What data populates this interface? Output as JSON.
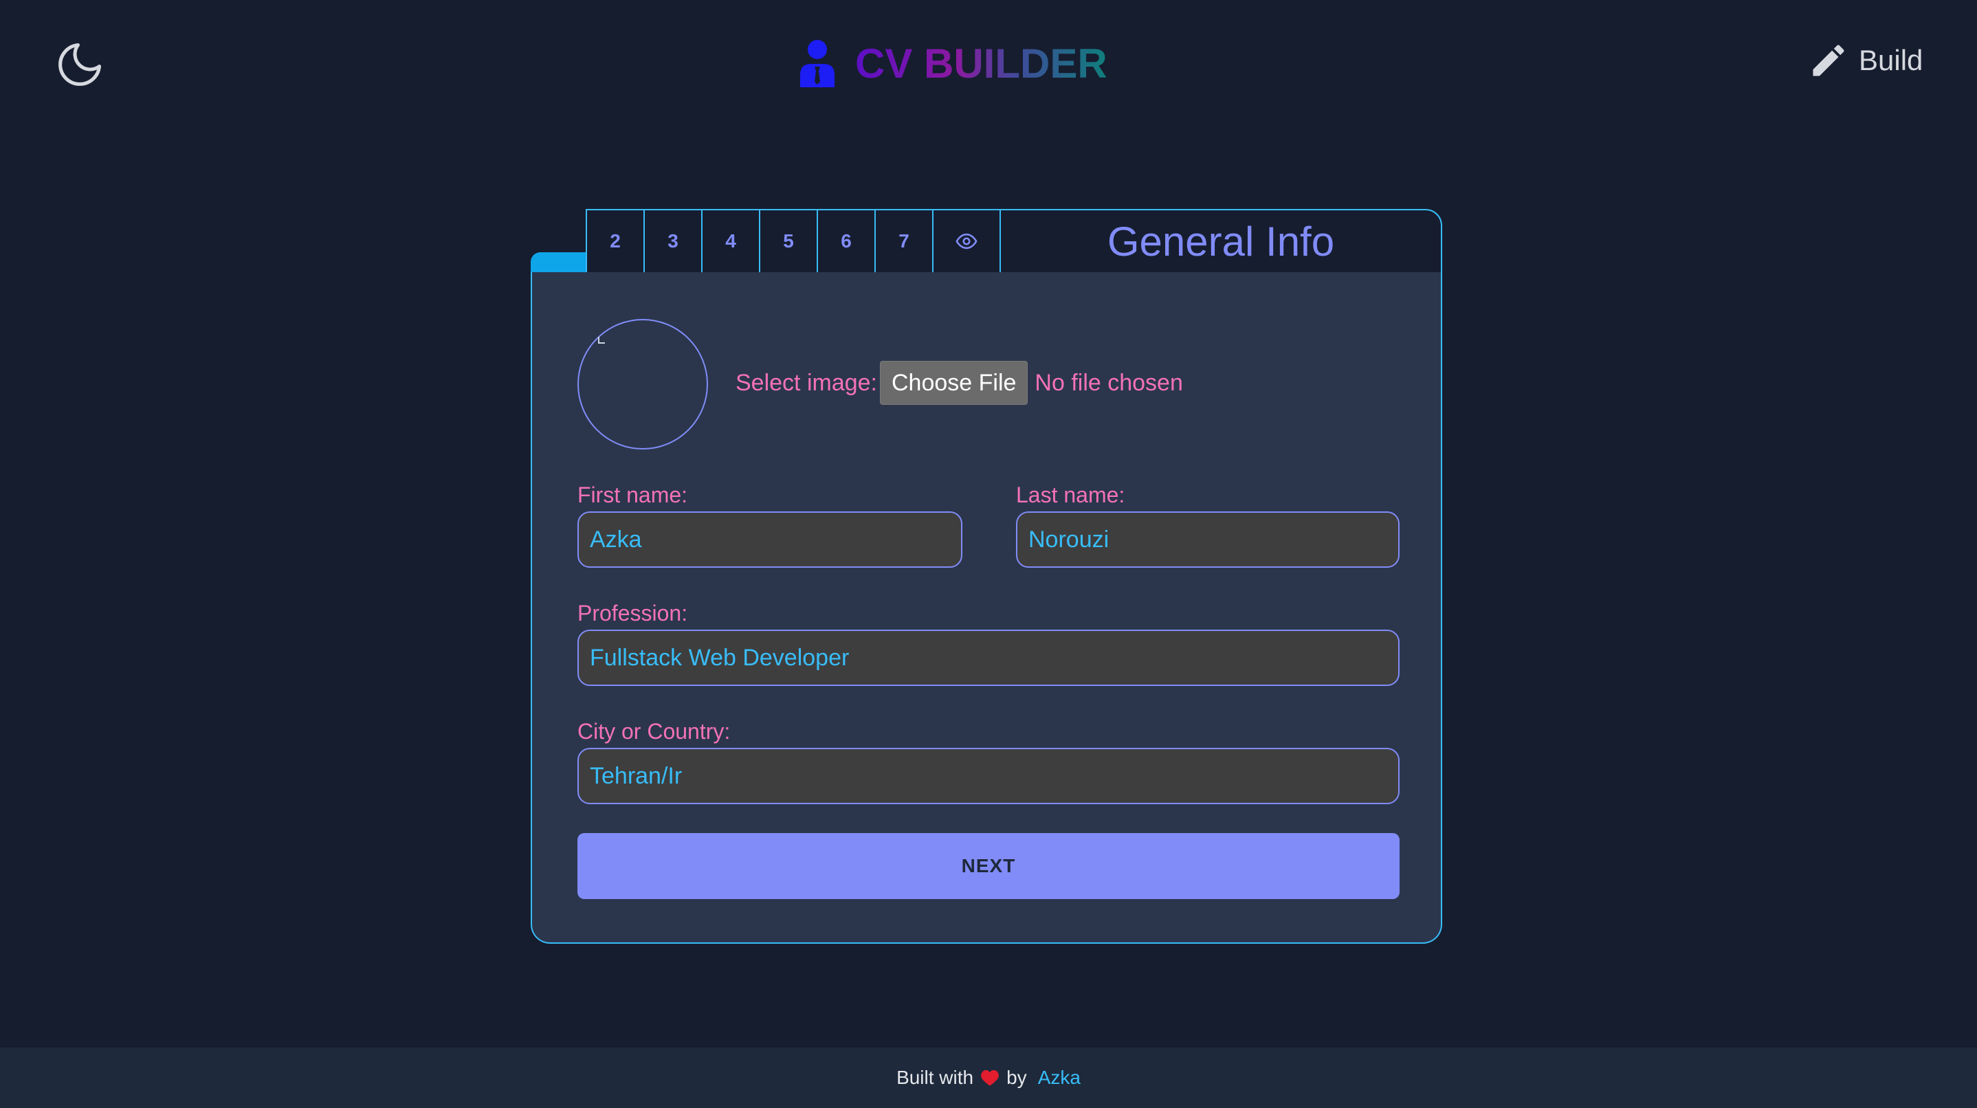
{
  "header": {
    "title": "CV BUILDER",
    "build_label": "Build",
    "icons": {
      "theme": "moon-icon",
      "brand": "user-icon",
      "build": "pencil-icon"
    }
  },
  "tabs": {
    "items": [
      "2",
      "3",
      "4",
      "5",
      "6",
      "7"
    ],
    "preview_icon": "eye-icon",
    "section_title": "General Info"
  },
  "form": {
    "image_label": "Select image:",
    "choose_file_label": "Choose File",
    "no_file_text": "No file chosen",
    "first_name_label": "First name:",
    "first_name_value": "Azka",
    "last_name_label": "Last name:",
    "last_name_value": "Norouzi",
    "profession_label": "Profession:",
    "profession_value": "Fullstack Web Developer",
    "city_label": "City or Country:",
    "city_value": "Tehran/Ir",
    "next_label": "NEXT"
  },
  "footer": {
    "built_with": "Built with",
    "by": "by",
    "author": "Azka"
  },
  "colors": {
    "background": "#161d2f",
    "card": "#2b364d",
    "accent_blue": "#38bdf8",
    "accent_indigo": "#818cf8",
    "label_pink": "#f472b6"
  }
}
